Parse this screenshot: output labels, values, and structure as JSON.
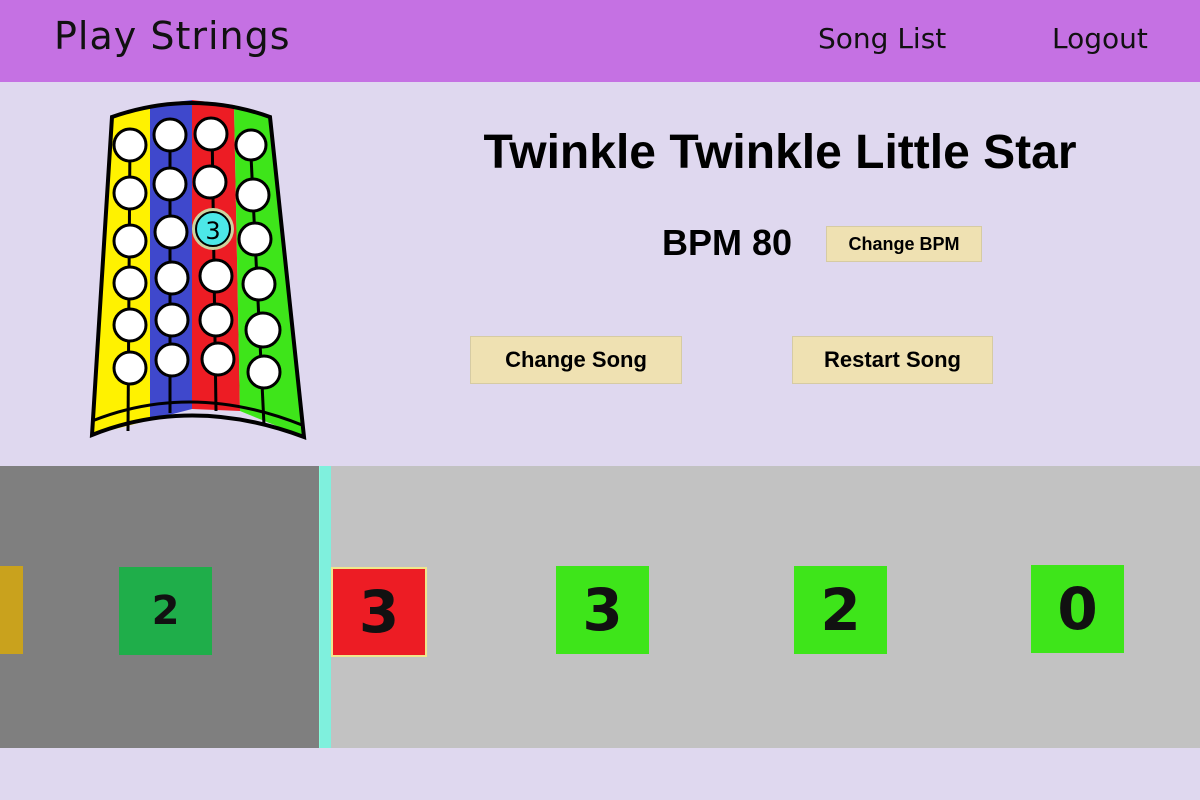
{
  "header": {
    "brand": "Play Strings",
    "nav": {
      "song_list": "Song List",
      "logout": "Logout"
    },
    "background_color": "#c571e3"
  },
  "instrument": {
    "string_colors": [
      "#fff200",
      "#3f48cc",
      "#ed1c24",
      "#3ee51a"
    ],
    "highlighted_fret_label": "3",
    "highlight_color": "#4ce8e8"
  },
  "song": {
    "title": "Twinkle Twinkle Little Star",
    "bpm_label": "BPM 80",
    "change_bpm_label": "Change BPM",
    "change_song_label": "Change Song",
    "restart_song_label": "Restart Song"
  },
  "track": {
    "notes": [
      {
        "label": "2",
        "color": "#1fae4a",
        "state": "played"
      },
      {
        "label": "3",
        "color": "#ed1c24",
        "state": "current"
      },
      {
        "label": "3",
        "color": "#3ee51a",
        "state": "upcoming"
      },
      {
        "label": "2",
        "color": "#3ee51a",
        "state": "upcoming"
      },
      {
        "label": "0",
        "color": "#3ee51a",
        "state": "upcoming"
      }
    ]
  }
}
